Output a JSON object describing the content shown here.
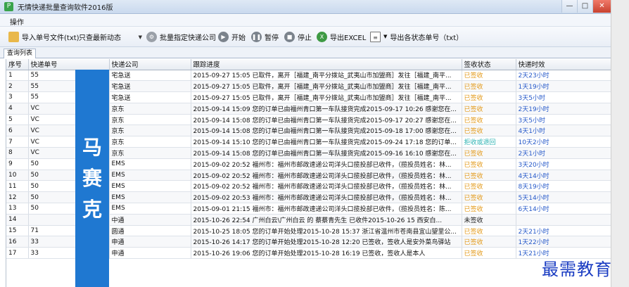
{
  "window": {
    "title": "无情快递批量查询软件2016版",
    "app_icon_char": "P",
    "controls": [
      "—",
      "□",
      "✕"
    ]
  },
  "menu": {
    "items": [
      "操作"
    ]
  },
  "toolbar": {
    "import_label": "导入单号文件(txt)",
    "filter_select": "只查最新动态",
    "batch_courier_label": "批量指定快递公司",
    "start_label": "开始",
    "pause_label": "暂停",
    "stop_label": "停止",
    "export_excel_label": "导出EXCEL",
    "export_status_label": "导出各状态单号（txt）"
  },
  "tabs": [
    {
      "label": "查询列表"
    }
  ],
  "table": {
    "columns": [
      "序号",
      "快递单号",
      "快递公司",
      "跟踪进度",
      "签收状态",
      "快递时效"
    ],
    "rows": [
      {
        "no": "1",
        "tracking": "55",
        "company": "宅急送",
        "progress": "2015-09-27 15:05 已取件，离开［福建_南平分拨站_武夷山市加盟商］发往［福建_南平...",
        "status": "已签收",
        "status_type": "signed",
        "duration": "2天23小时"
      },
      {
        "no": "2",
        "tracking": "55",
        "company": "宅急送",
        "progress": "2015-09-27 15:05 已取件，离开［福建_南平分拨站_武夷山市加盟商］发往［福建_南平...",
        "status": "已签收",
        "status_type": "signed",
        "duration": "1天19小时"
      },
      {
        "no": "3",
        "tracking": "55",
        "company": "宅急送",
        "progress": "2015-09-27 15:05 已取件，离开［福建_南平分拨站_武夷山市加盟商］发往［福建_南平...",
        "status": "已签收",
        "status_type": "signed",
        "duration": "3天5小时"
      },
      {
        "no": "4",
        "tracking": "VC",
        "company": "京东",
        "progress": "2015-09-14 15:09 您的订单已由福州青口第一车队接货完成2015-09-17 10:26 感谢您在...",
        "status": "已签收",
        "status_type": "signed",
        "duration": "2天19小时"
      },
      {
        "no": "5",
        "tracking": "VC",
        "company": "京东",
        "progress": "2015-09-14 15:08 您的订单已由福州青口第一车队接货完成2015-09-17 20:27 感谢您在...",
        "status": "已签收",
        "status_type": "signed",
        "duration": "3天5小时"
      },
      {
        "no": "6",
        "tracking": "VC",
        "company": "京东",
        "progress": "2015-09-14 15:08 您的订单已由福州青口第一车队接货完成2015-09-18 17:00 感谢您在...",
        "status": "已签收",
        "status_type": "signed",
        "duration": "4天1小时"
      },
      {
        "no": "7",
        "tracking": "VC",
        "company": "京东",
        "progress": "2015-09-14 15:10 您的订单已由福州青口第一车队接货完成2015-09-24 17:18 您的订单...",
        "status": "拒收或退回",
        "status_type": "rejected",
        "duration": "10天2小时"
      },
      {
        "no": "8",
        "tracking": "VC",
        "company": "京东",
        "progress": "2015-09-14 15:08 您的订单已由福州青口第一车队接货完成2015-09-16 16:10 感谢您在...",
        "status": "已签收",
        "status_type": "signed",
        "duration": "2天1小时"
      },
      {
        "no": "9",
        "tracking": "50",
        "company": "EMS",
        "progress": "2015-09-02 20:52 福州市：福州市邮政速递公司洋头口揽投部已收件，（揽投员姓名：林...",
        "status": "已签收",
        "status_type": "signed",
        "duration": "3天20小时"
      },
      {
        "no": "10",
        "tracking": "50",
        "company": "EMS",
        "progress": "2015-09-02 20:52 福州市：福州市邮政速递公司洋头口揽投部已收件，（揽投员姓名：林...",
        "status": "已签收",
        "status_type": "signed",
        "duration": "4天14小时"
      },
      {
        "no": "11",
        "tracking": "50",
        "company": "EMS",
        "progress": "2015-09-02 20:52 福州市：福州市邮政速递公司洋头口揽投部已收件，（揽投员姓名：林...",
        "status": "已签收",
        "status_type": "signed",
        "duration": "8天19小时"
      },
      {
        "no": "12",
        "tracking": "50",
        "company": "EMS",
        "progress": "2015-09-02 20:53 福州市：福州市邮政速递公司洋头口揽投部已收件，（揽投员姓名：林...",
        "status": "已签收",
        "status_type": "signed",
        "duration": "5天14小时"
      },
      {
        "no": "13",
        "tracking": "50",
        "company": "EMS",
        "progress": "2015-09-01 21:15 福州市：福州市邮政速递公司洋头口揽投部已收件，（揽投员姓名：陈...",
        "status": "已签收",
        "status_type": "signed",
        "duration": "6天14小时"
      },
      {
        "no": "14",
        "tracking": "",
        "company": "中通",
        "progress": "2015-10-26 22:54 广州白云\\广州白云 的 蔡蔡青先生 已收件2015-10-26 15 西安白...",
        "status": "未签收",
        "status_type": "normal",
        "duration": ""
      },
      {
        "no": "15",
        "tracking": "71",
        "company": "圆通",
        "progress": "2015-10-25 18:05 您的订单开始处理2015-10-28 15:37 浙江省温州市苍南县宜山望里公...",
        "status": "已签收",
        "status_type": "signed",
        "duration": "2天21小时"
      },
      {
        "no": "16",
        "tracking": "33",
        "company": "申通",
        "progress": "2015-10-26 14:17 您的订单开始处理2015-10-28 12:20 已签收，签收人是安外菜鸟驿站",
        "status": "已签收",
        "status_type": "signed",
        "duration": "1天22小时"
      },
      {
        "no": "17",
        "tracking": "33",
        "company": "申通",
        "progress": "2015-10-26 19:06 您的订单开始处理2015-10-28 16:19 已签收，签收人是本人",
        "status": "已签收",
        "status_type": "signed",
        "duration": "1天21小时"
      }
    ]
  },
  "overlay": {
    "chars": [
      "马",
      "赛",
      "克"
    ],
    "color": "#1f78d1"
  },
  "watermark": {
    "text": "最需教育",
    "color": "#1a3cc2"
  },
  "colors": {
    "signed": "#e39a1a",
    "rejected": "#2db3b3",
    "duration": "#2659c9"
  }
}
